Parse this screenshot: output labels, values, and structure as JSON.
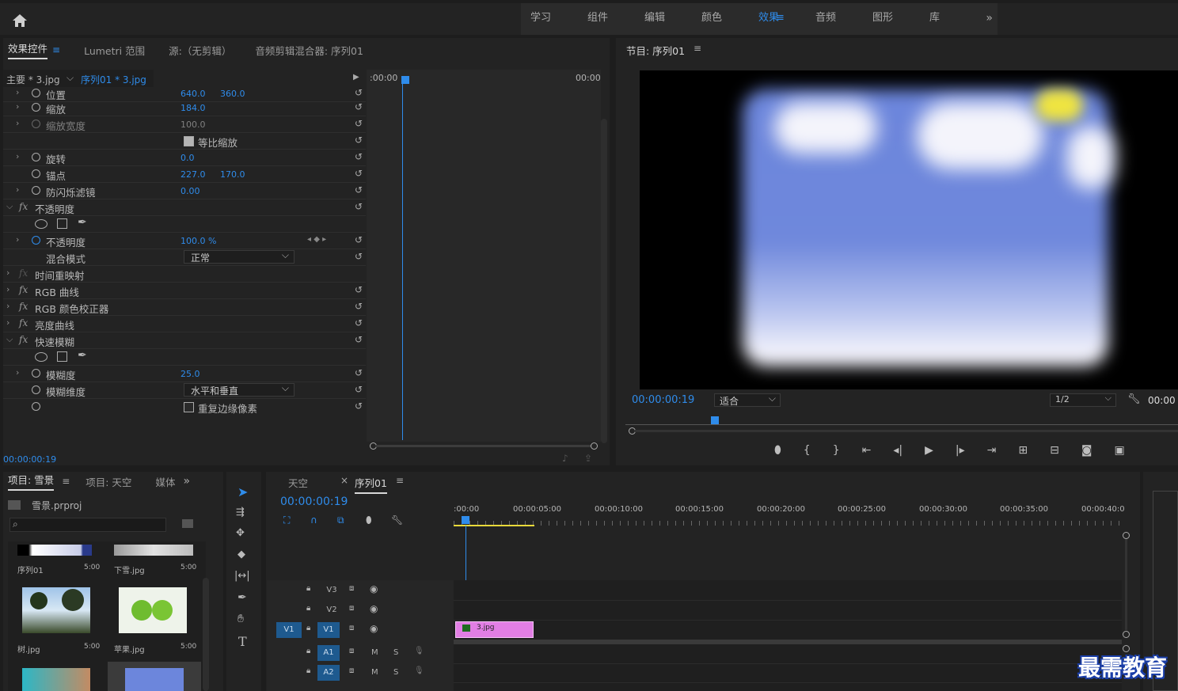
{
  "workspace": {
    "tabs": [
      "学习",
      "组件",
      "编辑",
      "颜色",
      "效果",
      "音频",
      "图形",
      "库"
    ],
    "active": "效果",
    "menu_icon": "≡",
    "more": "»"
  },
  "effect_controls": {
    "tabs": [
      "效果控件",
      "Lumetri 范围",
      "源:（无剪辑）",
      "音频剪辑混合器: 序列01"
    ],
    "menu": "≡",
    "clip_master": "主要 * 3.jpg",
    "clip_seq": "序列01 * 3.jpg",
    "ruler_start": ":00:00",
    "ruler_end": "00:00",
    "rows": [
      {
        "name": "位置",
        "v1": "640.0",
        "v2": "360.0"
      },
      {
        "name": "缩放",
        "v1": "184.0"
      },
      {
        "name": "缩放宽度",
        "v1": "100.0"
      },
      {
        "name": "等比缩放"
      },
      {
        "name": "旋转",
        "v1": "0.0"
      },
      {
        "name": "锚点",
        "v1": "227.0",
        "v2": "170.0"
      },
      {
        "name": "防闪烁滤镜",
        "v1": "0.00"
      },
      {
        "name": "不透明度"
      },
      {
        "name": "不透明度",
        "v1": "100.0 %"
      },
      {
        "name": "混合模式",
        "select": "正常"
      },
      {
        "name": "时间重映射"
      },
      {
        "name": "RGB 曲线"
      },
      {
        "name": "RGB 颜色校正器"
      },
      {
        "name": "亮度曲线"
      },
      {
        "name": "快速模糊"
      },
      {
        "name": "模糊度",
        "v1": "25.0"
      },
      {
        "name": "模糊维度",
        "select": "水平和垂直"
      },
      {
        "name": "重复边缘像素"
      }
    ],
    "timecode": "00:00:00:19"
  },
  "program": {
    "title": "节目: 序列01",
    "menu": "≡",
    "timecode": "00:00:00:19",
    "fit": "适合",
    "resolution": "1/2",
    "right_tc": "00:00"
  },
  "project": {
    "tabs": [
      "项目: 雪景",
      "项目: 天空",
      "媒体"
    ],
    "menu": "≡",
    "more": "»",
    "file": "雪景.prproj",
    "items": [
      {
        "name": "序列01",
        "dur": "5:00"
      },
      {
        "name": "下雪.jpg",
        "dur": "5:00"
      },
      {
        "name": "树.jpg",
        "dur": "5:00"
      },
      {
        "name": "苹果.jpg",
        "dur": "5:00"
      }
    ]
  },
  "timeline": {
    "tabs": [
      "天空",
      "序列01"
    ],
    "close": "×",
    "menu": "≡",
    "timecode": "00:00:00:19",
    "ruler": [
      ":00:00",
      "00:00:05:00",
      "00:00:10:00",
      "00:00:15:00",
      "00:00:20:00",
      "00:00:25:00",
      "00:00:30:00",
      "00:00:35:00",
      "00:00:40:0"
    ],
    "tracks": [
      "V3",
      "V2",
      "V1",
      "A1",
      "A2"
    ],
    "src_v1": "V1",
    "m": "M",
    "s": "S",
    "clip": "3.jpg"
  },
  "watermark": "最需教育",
  "colors": {
    "accent": "#2f8ceb",
    "clip": "#e27ee4",
    "sky": "#6c86dc"
  }
}
